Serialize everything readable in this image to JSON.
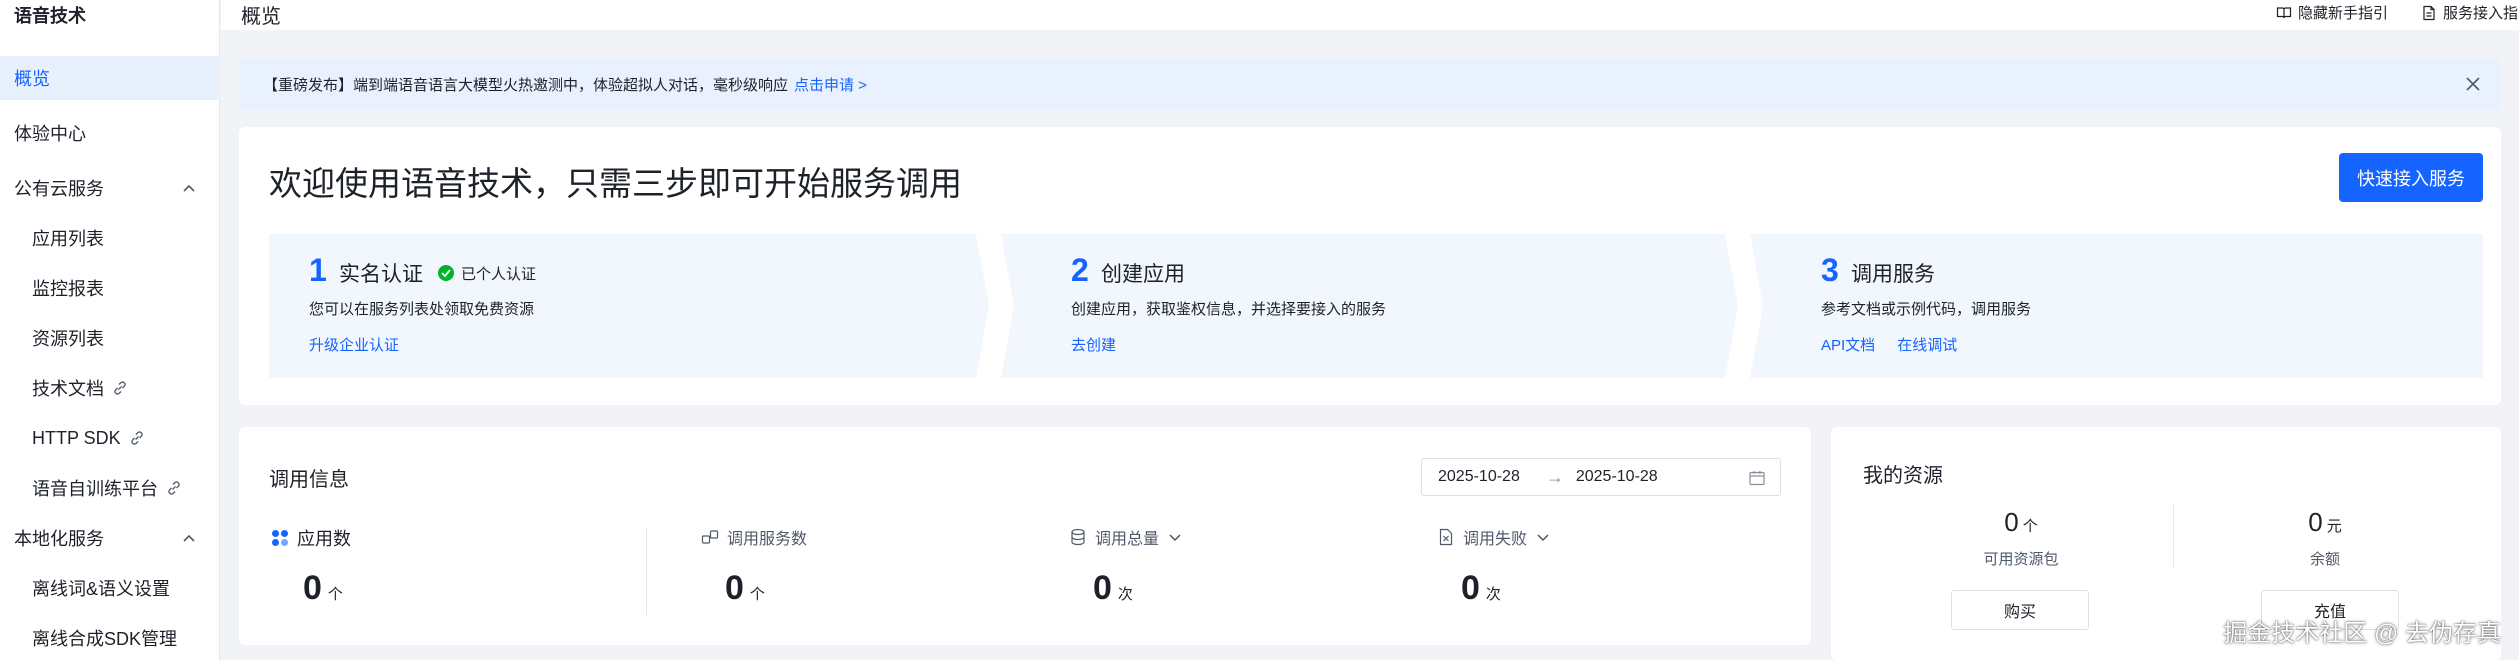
{
  "sidebar": {
    "title": "语音技术",
    "items": [
      {
        "label": "概览"
      },
      {
        "label": "体验中心"
      },
      {
        "label": "公有云服务"
      },
      {
        "label": "应用列表"
      },
      {
        "label": "监控报表"
      },
      {
        "label": "资源列表"
      },
      {
        "label": "技术文档"
      },
      {
        "label": "HTTP SDK"
      },
      {
        "label": "语音自训练平台"
      },
      {
        "label": "本地化服务"
      },
      {
        "label": "离线词&语义设置"
      },
      {
        "label": "离线合成SDK管理"
      }
    ]
  },
  "header": {
    "title": "概览",
    "hide_guide": "隐藏新手指引",
    "service_access": "服务接入指"
  },
  "banner": {
    "text": "【重磅发布】端到端语音语言大模型火热邀测中，体验超拟人对话，毫秒级响应",
    "link": "点击申请 >"
  },
  "welcome": {
    "title": "欢迎使用语音技术，只需三步即可开始服务调用",
    "quick_button": "快速接入服务",
    "steps": [
      {
        "num": "1",
        "name": "实名认证",
        "badge": "已个人认证",
        "desc": "您可以在服务列表处领取免费资源",
        "links": [
          "升级企业认证"
        ]
      },
      {
        "num": "2",
        "name": "创建应用",
        "desc": "创建应用，获取鉴权信息，并选择要接入的服务",
        "links": [
          "去创建"
        ]
      },
      {
        "num": "3",
        "name": "调用服务",
        "desc": "参考文档或示例代码，调用服务",
        "links": [
          "API文档",
          "在线调试"
        ]
      }
    ]
  },
  "call_info": {
    "title": "调用信息",
    "date_start": "2025-10-28",
    "date_arrow": "→",
    "date_end": "2025-10-28",
    "metrics": [
      {
        "label": "应用数",
        "value": "0",
        "unit": "个"
      },
      {
        "label": "调用服务数",
        "value": "0",
        "unit": "个"
      },
      {
        "label": "调用总量",
        "value": "0",
        "unit": "次"
      },
      {
        "label": "调用失败",
        "value": "0",
        "unit": "次"
      }
    ]
  },
  "resources": {
    "title": "我的资源",
    "available": {
      "value": "0",
      "unit": "个",
      "label": "可用资源包"
    },
    "balance": {
      "value": "0",
      "unit": "元",
      "label": "余额"
    },
    "buy_button": "购买",
    "recharge_button": "充值"
  },
  "watermark": "掘金技术社区 @ 去伪存真",
  "colors": {
    "accent": "#1664ff",
    "banner_bg": "#eaf1fe",
    "success": "#00b42a"
  }
}
